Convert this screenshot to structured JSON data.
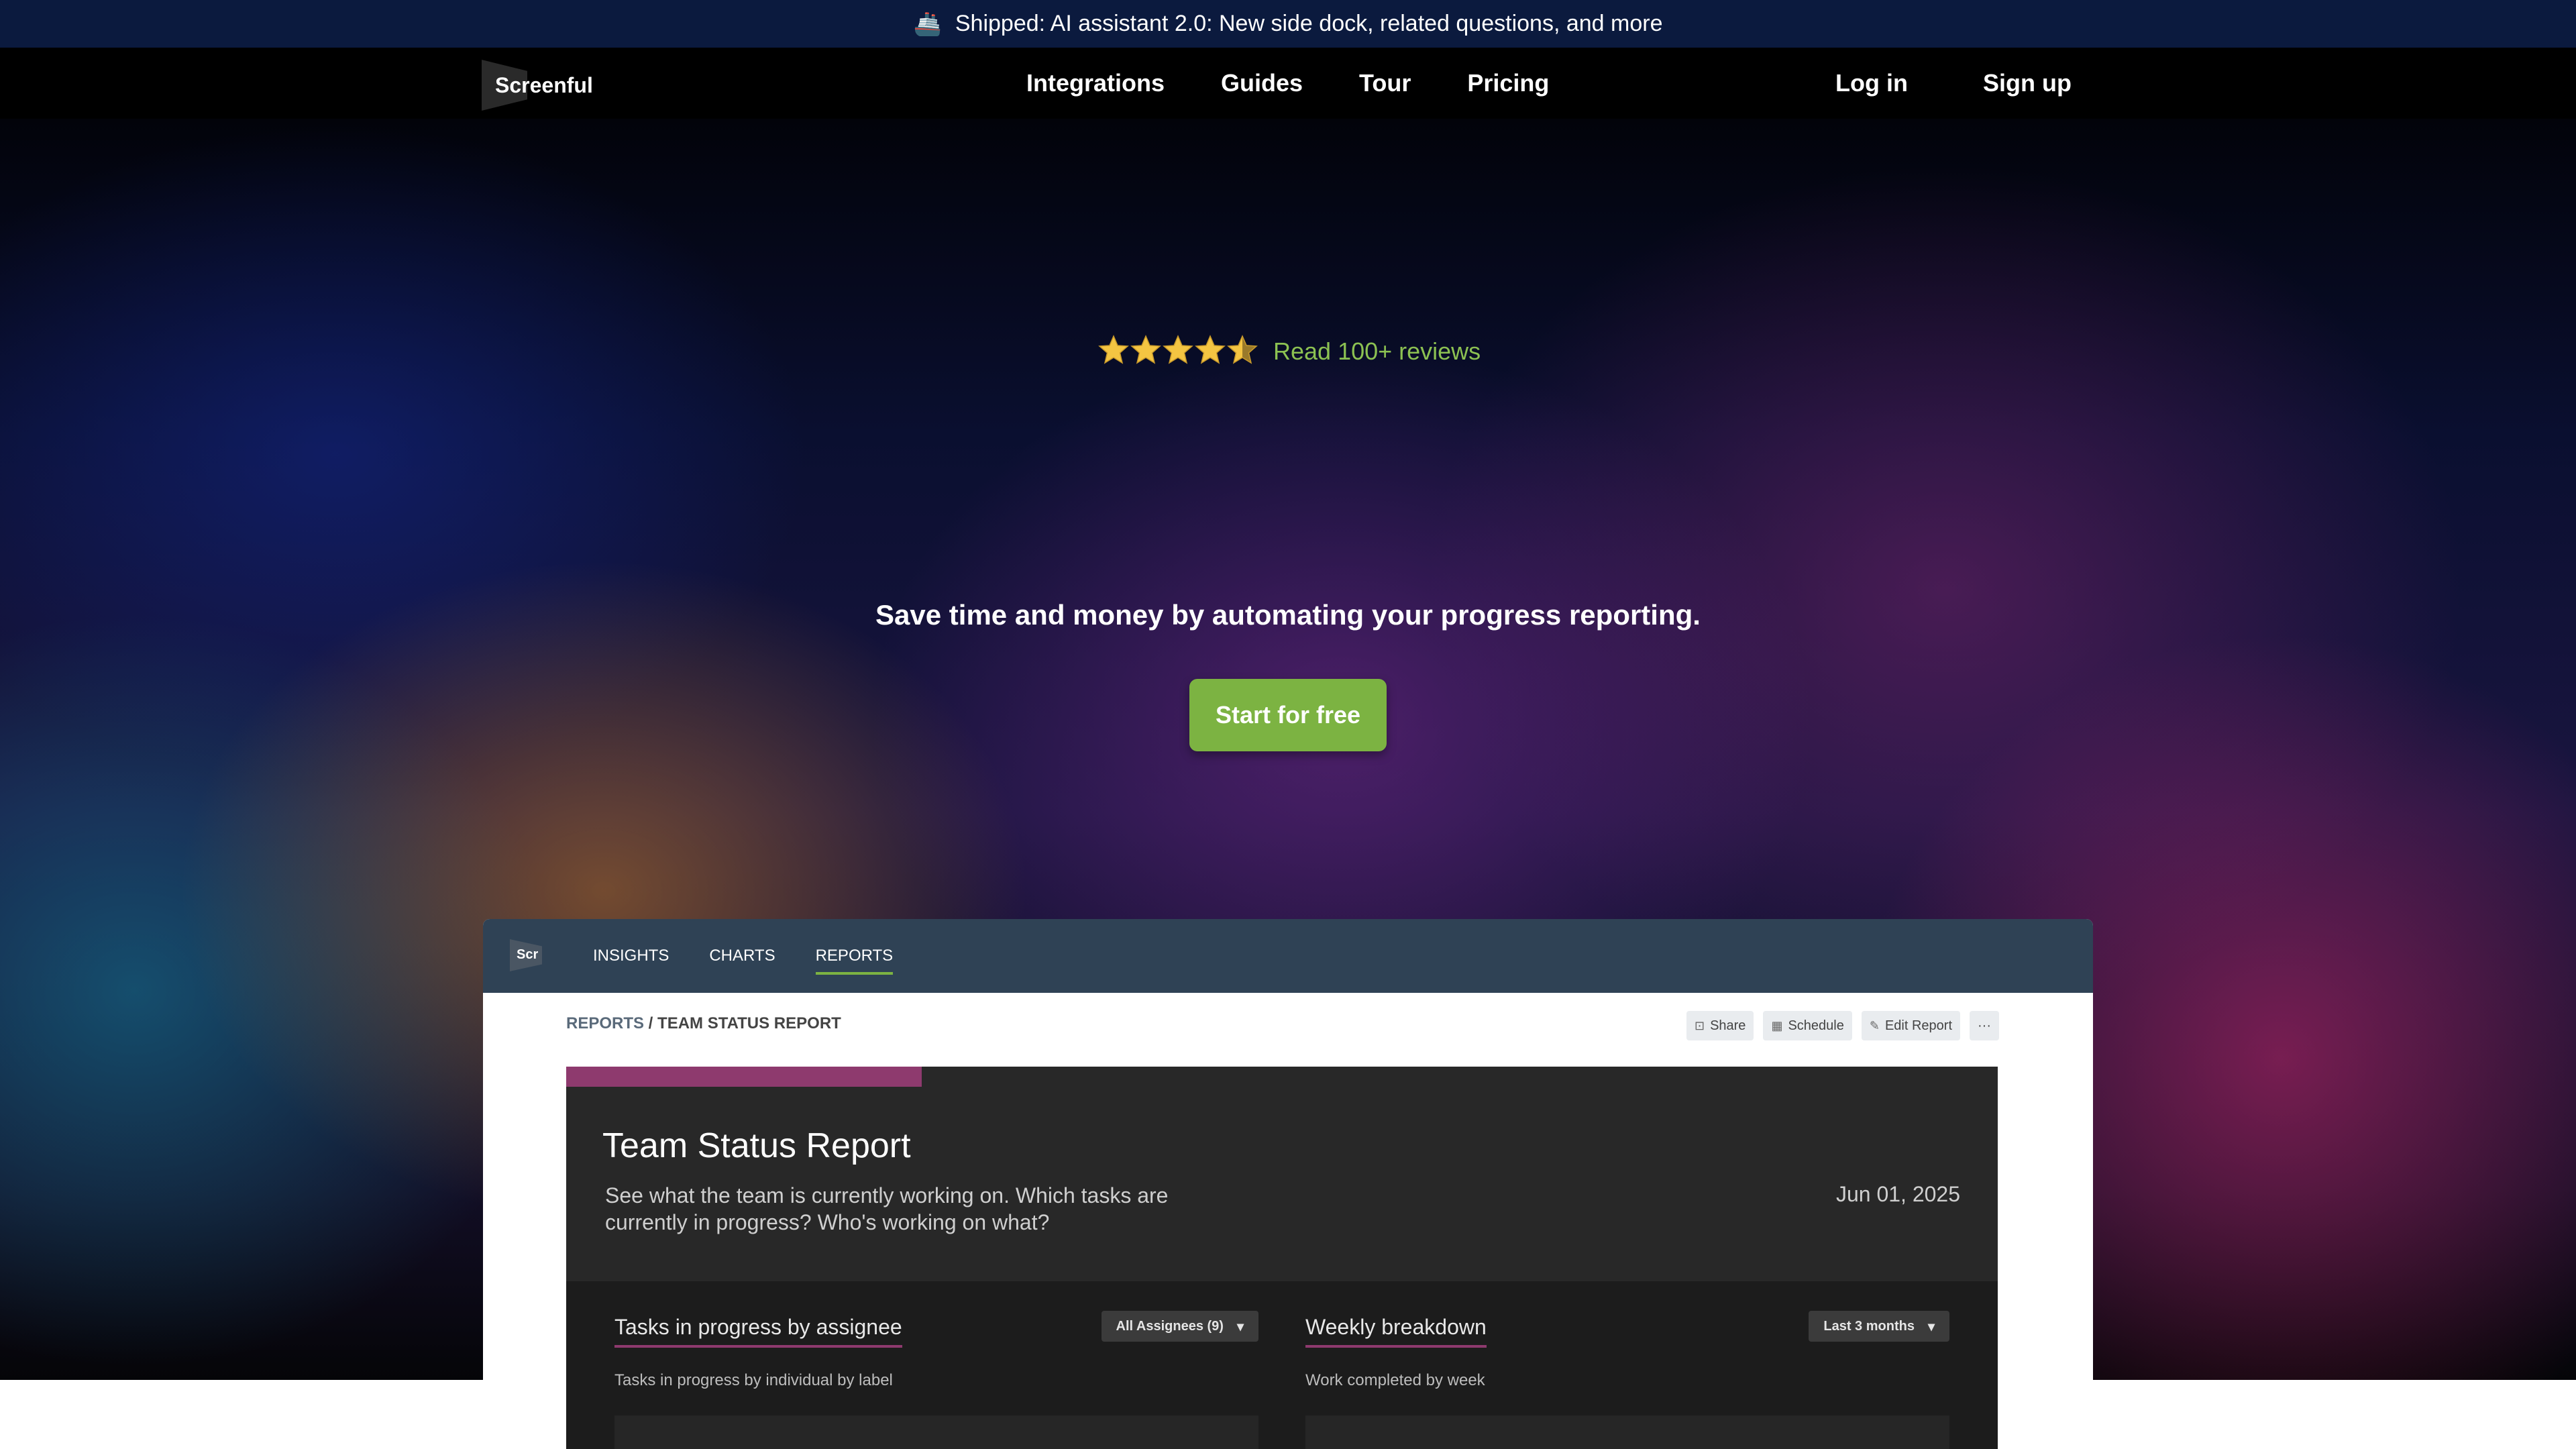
{
  "banner": {
    "icon": "ship-icon",
    "text": "Shipped: AI assistant 2.0: New side dock, related questions, and more"
  },
  "nav": {
    "logo": "Screenful",
    "links": [
      "Integrations",
      "Guides",
      "Tour",
      "Pricing"
    ],
    "login": "Log in",
    "signup": "Sign up"
  },
  "hero": {
    "rating": 4.5,
    "rating_max": 5,
    "reviews_link": "Read 100+ reviews",
    "tagline": "Save time and money by automating your progress reporting.",
    "cta": "Start for free"
  },
  "app": {
    "logo_text": "Scr",
    "tabs": [
      "INSIGHTS",
      "CHARTS",
      "REPORTS"
    ],
    "active_tab": "REPORTS",
    "breadcrumb": {
      "root": "REPORTS",
      "separator": " / ",
      "current": "TEAM STATUS REPORT"
    },
    "actions": [
      "Share",
      "Schedule",
      "Edit Report",
      "···"
    ],
    "report": {
      "title": "Team Status Report",
      "description": "See what the team is currently working on. Which tasks are currently in progress? Who's working on what?",
      "date": "Jun 01, 2025"
    },
    "panels": [
      {
        "title": "Tasks in progress by assignee",
        "subtitle": "Tasks in progress by individual by label",
        "select": "All Assignees (9)"
      },
      {
        "title": "Weekly breakdown",
        "subtitle": "Work completed by week",
        "select": "Last 3 months"
      }
    ]
  },
  "colors": {
    "accent_green": "#7cb342",
    "banner_bg": "#0b1a3e",
    "report_accent": "#8e3a6e",
    "review_link": "#8cc152"
  }
}
